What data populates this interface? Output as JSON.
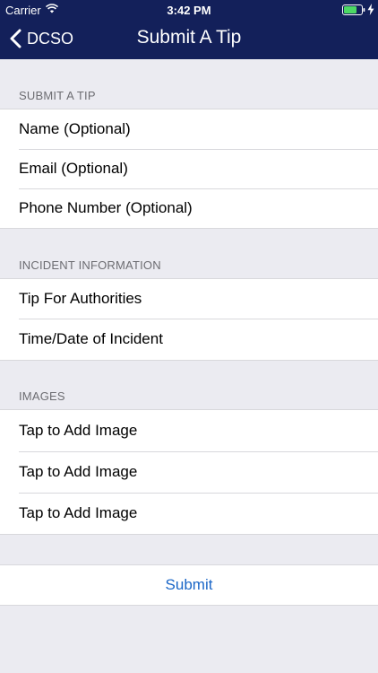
{
  "status_bar": {
    "carrier": "Carrier",
    "time": "3:42 PM",
    "icons": [
      "wifi-icon",
      "battery-icon",
      "charging-bolt-icon"
    ]
  },
  "nav": {
    "back_label": "DCSO",
    "title": "Submit A Tip"
  },
  "sections": {
    "tip": {
      "header": "SUBMIT A TIP",
      "rows": [
        "Name (Optional)",
        "Email (Optional)",
        "Phone Number (Optional)"
      ]
    },
    "incident": {
      "header": "INCIDENT INFORMATION",
      "rows": [
        "Tip For Authorities",
        "Time/Date of Incident"
      ]
    },
    "images": {
      "header": "IMAGES",
      "rows": [
        "Tap to Add Image",
        "Tap to Add Image",
        "Tap to Add Image"
      ]
    }
  },
  "submit_label": "Submit",
  "colors": {
    "nav_background": "#13205a",
    "page_background": "#ebebf1",
    "accent": "#1a66c7",
    "battery": "#4cd964"
  }
}
